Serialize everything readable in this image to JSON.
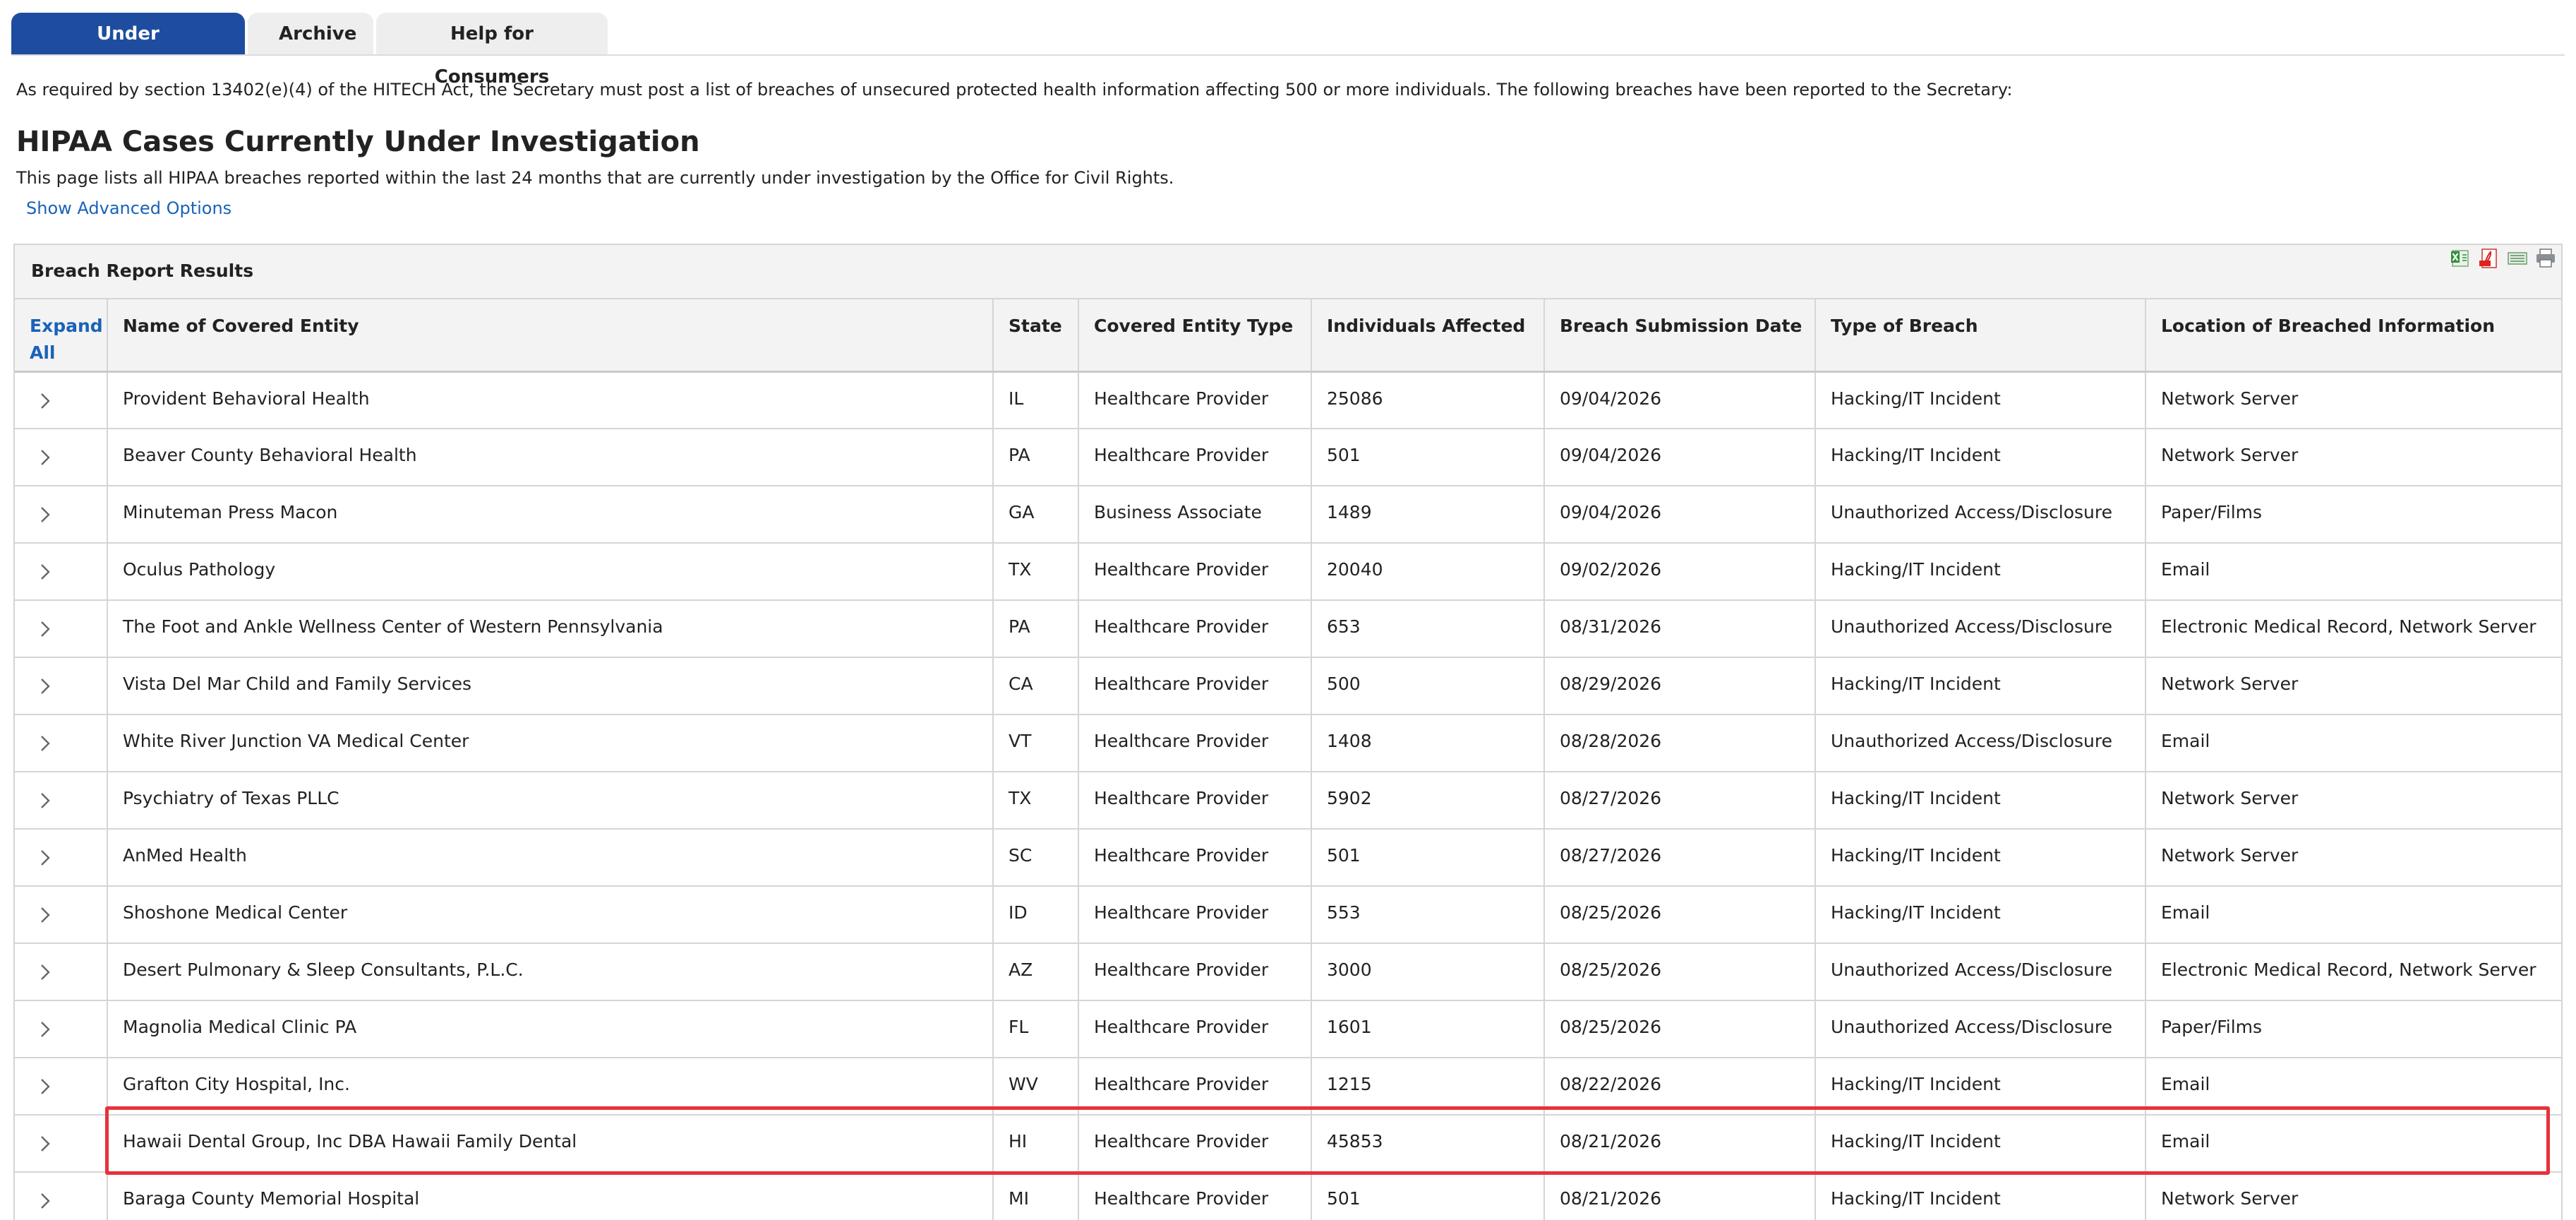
{
  "tabs": [
    "Under Investigation",
    "Archive",
    "Help for Consumers"
  ],
  "intro_text": "As required by section 13402(e)(4) of the HITECH Act, the Secretary must post a list of breaches of unsecured protected health information affecting 500 or more individuals. The following breaches have been reported to the Secretary:",
  "title": "HIPAA Cases Currently Under Investigation",
  "subtitle": "This page lists all HIPAA breaches reported within the last 24 months that are currently under investigation by the Office for Civil Rights.",
  "advanced_link": "Show Advanced Options",
  "results": {
    "title": "Breach Report Results",
    "export_icons": [
      "excel-export-icon",
      "pdf-export-icon",
      "csv-export-icon",
      "print-icon"
    ],
    "columns": {
      "expand_all": "Expand All",
      "name": "Name of Covered Entity",
      "state": "State",
      "entity_type": "Covered Entity Type",
      "individuals": "Individuals Affected",
      "date": "Breach Submission Date",
      "breach_type": "Type of Breach",
      "location": "Location of Breached Information"
    },
    "rows": [
      {
        "name": "Provident Behavioral Health",
        "state": "IL",
        "type": "Healthcare Provider",
        "individuals": "25086",
        "date": "09/04/2026",
        "breach": "Hacking/IT Incident",
        "location": "Network Server"
      },
      {
        "name": "Beaver County Behavioral Health",
        "state": "PA",
        "type": "Healthcare Provider",
        "individuals": "501",
        "date": "09/04/2026",
        "breach": "Hacking/IT Incident",
        "location": "Network Server"
      },
      {
        "name": "Minuteman Press Macon",
        "state": "GA",
        "type": "Business Associate",
        "individuals": "1489",
        "date": "09/04/2026",
        "breach": "Unauthorized Access/Disclosure",
        "location": "Paper/Films"
      },
      {
        "name": "Oculus Pathology",
        "state": "TX",
        "type": "Healthcare Provider",
        "individuals": "20040",
        "date": "09/02/2026",
        "breach": "Hacking/IT Incident",
        "location": "Email"
      },
      {
        "name": "The Foot and Ankle Wellness Center of Western Pennsylvania",
        "state": "PA",
        "type": "Healthcare Provider",
        "individuals": "653",
        "date": "08/31/2026",
        "breach": "Unauthorized Access/Disclosure",
        "location": "Electronic Medical Record, Network Server"
      },
      {
        "name": "Vista Del Mar Child and Family Services",
        "state": "CA",
        "type": "Healthcare Provider",
        "individuals": "500",
        "date": "08/29/2026",
        "breach": "Hacking/IT Incident",
        "location": "Network Server"
      },
      {
        "name": "White River Junction VA Medical Center",
        "state": "VT",
        "type": "Healthcare Provider",
        "individuals": "1408",
        "date": "08/28/2026",
        "breach": "Unauthorized Access/Disclosure",
        "location": "Email"
      },
      {
        "name": "Psychiatry of Texas PLLC",
        "state": "TX",
        "type": "Healthcare Provider",
        "individuals": "5902",
        "date": "08/27/2026",
        "breach": "Hacking/IT Incident",
        "location": "Network Server"
      },
      {
        "name": "AnMed Health",
        "state": "SC",
        "type": "Healthcare Provider",
        "individuals": "501",
        "date": "08/27/2026",
        "breach": "Hacking/IT Incident",
        "location": "Network Server"
      },
      {
        "name": "Shoshone Medical Center",
        "state": "ID",
        "type": "Healthcare Provider",
        "individuals": "553",
        "date": "08/25/2026",
        "breach": "Hacking/IT Incident",
        "location": "Email"
      },
      {
        "name": "Desert Pulmonary & Sleep Consultants, P.L.C.",
        "state": "AZ",
        "type": "Healthcare Provider",
        "individuals": "3000",
        "date": "08/25/2026",
        "breach": "Unauthorized Access/Disclosure",
        "location": "Electronic Medical Record, Network Server"
      },
      {
        "name": "Magnolia Medical Clinic PA",
        "state": "FL",
        "type": "Healthcare Provider",
        "individuals": "1601",
        "date": "08/25/2026",
        "breach": "Unauthorized Access/Disclosure",
        "location": "Paper/Films"
      },
      {
        "name": "Grafton City Hospital, Inc.",
        "state": "WV",
        "type": "Healthcare Provider",
        "individuals": "1215",
        "date": "08/22/2026",
        "breach": "Hacking/IT Incident",
        "location": "Email"
      },
      {
        "name": "Hawaii Dental Group, Inc DBA Hawaii Family Dental",
        "state": "HI",
        "type": "Healthcare Provider",
        "individuals": "45853",
        "date": "08/21/2026",
        "breach": "Hacking/IT Incident",
        "location": "Email"
      },
      {
        "name": "Baraga County Memorial Hospital",
        "state": "MI",
        "type": "Healthcare Provider",
        "individuals": "501",
        "date": "08/21/2026",
        "breach": "Hacking/IT Incident",
        "location": "Network Server"
      }
    ]
  }
}
